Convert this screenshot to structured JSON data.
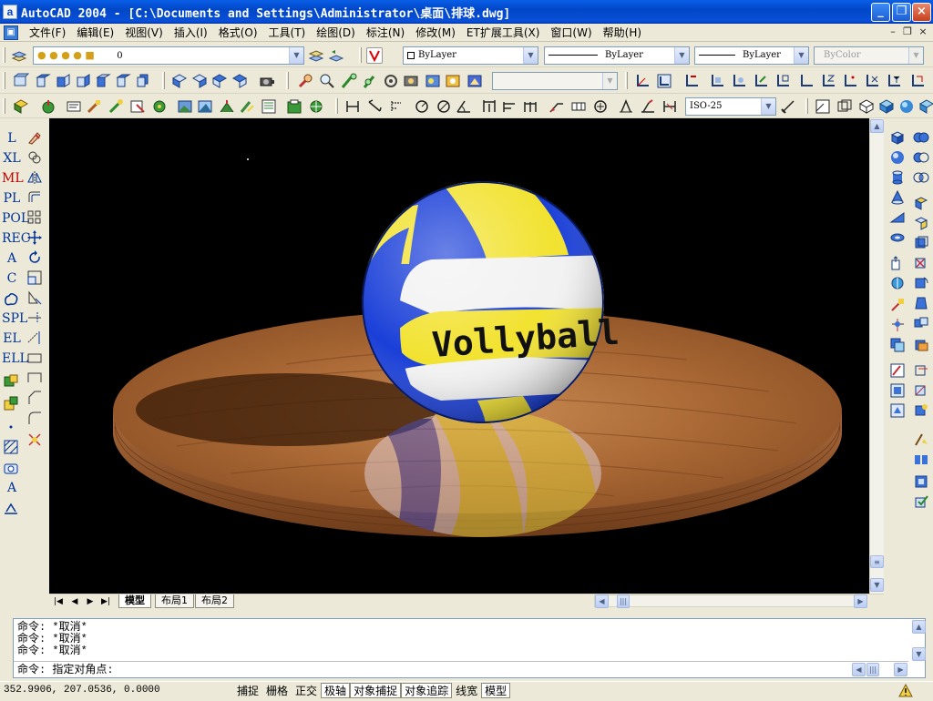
{
  "window": {
    "title": "AutoCAD 2004 - [C:\\Documents and Settings\\Administrator\\桌面\\排球.dwg]",
    "app_icon_glyph": "a"
  },
  "menubar": {
    "items": [
      "文件(F)",
      "编辑(E)",
      "视图(V)",
      "插入(I)",
      "格式(O)",
      "工具(T)",
      "绘图(D)",
      "标注(N)",
      "修改(M)",
      "ET扩展工具(X)",
      "窗口(W)",
      "帮助(H)"
    ]
  },
  "layers_toolbar": {
    "current_layer": "0"
  },
  "properties_toolbar": {
    "color": "ByLayer",
    "linetype": "ByLayer",
    "lineweight": "ByLayer",
    "plotstyle": "ByColor"
  },
  "dimstyle": {
    "value": "ISO-25"
  },
  "left_draw_commands": [
    "L",
    "XL",
    "ML",
    "PL",
    "POL",
    "REC",
    "A",
    "C",
    "",
    "SPL",
    "EL",
    "ELL",
    "",
    "",
    "",
    "",
    "",
    "A",
    ""
  ],
  "scene": {
    "ball_text": "Vollyball",
    "colors": {
      "background": "#000000",
      "ball_blue": "#1a3fd8",
      "ball_yellow": "#f2e230",
      "ball_white": "#f2f2f2",
      "wood": "#b5703a"
    }
  },
  "layout_tabs": [
    "模型",
    "布局1",
    "布局2"
  ],
  "command_window": {
    "history": [
      "命令: *取消*",
      "命令: *取消*",
      "命令: *取消*"
    ],
    "prompt": "命令: 指定对角点:"
  },
  "statusbar": {
    "coordinates": "352.9906, 207.0536, 0.0000",
    "toggles": [
      {
        "label": "捕捉",
        "on": false
      },
      {
        "label": "栅格",
        "on": false
      },
      {
        "label": "正交",
        "on": false
      },
      {
        "label": "极轴",
        "on": true
      },
      {
        "label": "对象捕捉",
        "on": true
      },
      {
        "label": "对象追踪",
        "on": true
      },
      {
        "label": "线宽",
        "on": false
      },
      {
        "label": "模型",
        "on": true
      }
    ]
  }
}
